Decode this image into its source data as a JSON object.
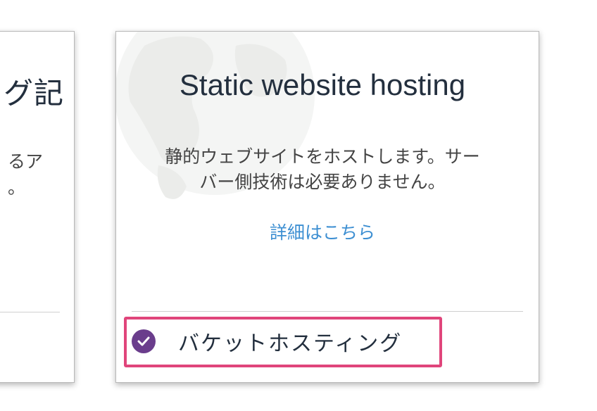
{
  "left_card": {
    "title_fragment": "グ記",
    "description_lines": [
      "るア",
      "。"
    ]
  },
  "main_card": {
    "title": "Static website hosting",
    "description_lines": [
      "静的ウェブサイトをホストします。サー",
      "バー側技術は必要ありません。"
    ],
    "learn_more": "詳細はこちら",
    "selection_label": "バケットホスティング",
    "selected": true
  },
  "icons": {
    "background": "globe-icon",
    "selected": "check-circle-icon"
  },
  "colors": {
    "accent_purple": "#6a3d8c",
    "link_blue": "#3d8fd2",
    "highlight_pink": "#e0457b",
    "text_dark": "#232f3e"
  }
}
